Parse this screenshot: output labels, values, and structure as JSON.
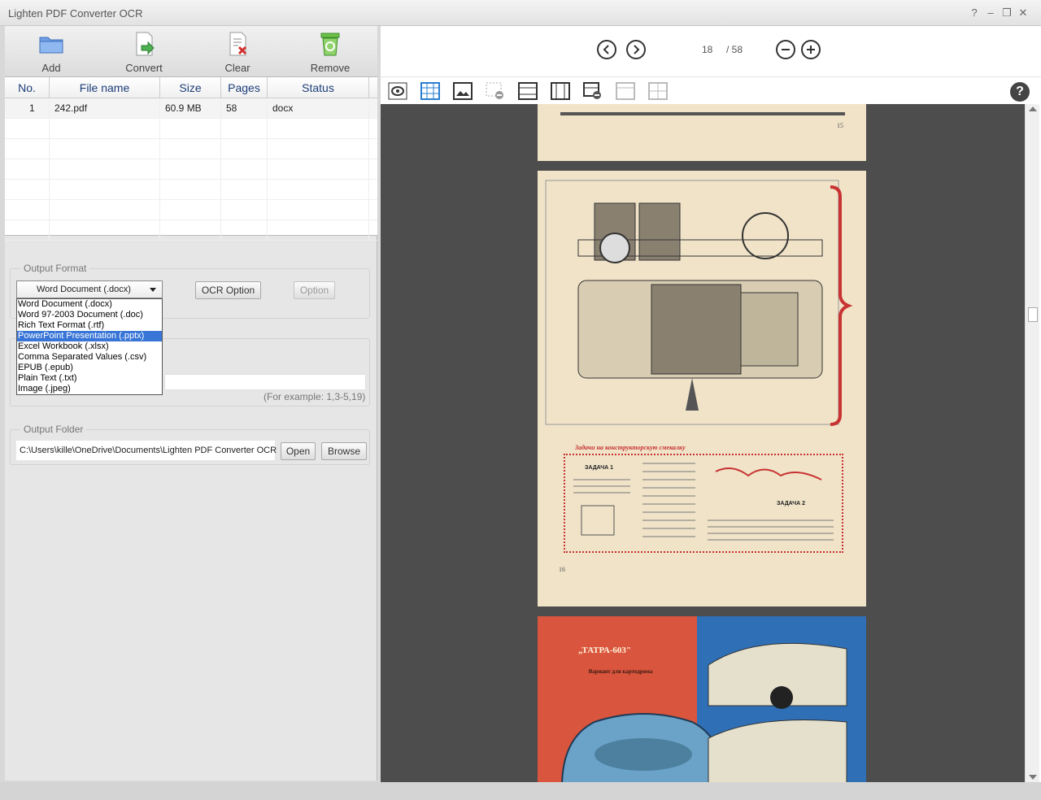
{
  "app": {
    "title": "Lighten PDF Converter OCR"
  },
  "window_controls": {
    "help": "?",
    "minimize": "–",
    "restore": "❐",
    "close": "✕"
  },
  "toolbar": {
    "add_label": "Add",
    "convert_label": "Convert",
    "clear_label": "Clear",
    "remove_label": "Remove"
  },
  "file_table": {
    "headers": {
      "no": "No.",
      "name": "File name",
      "size": "Size",
      "pages": "Pages",
      "status": "Status"
    },
    "rows": [
      {
        "no": "1",
        "name": "242.pdf",
        "size": "60.9 MB",
        "pages": "58",
        "status": "docx"
      }
    ]
  },
  "output_format": {
    "group_label": "Output Format",
    "selected": "Word Document (.docx)",
    "ocr_button": "OCR Option",
    "option_button": "Option",
    "options": [
      "Word Document (.docx)",
      "Word 97-2003 Document (.doc)",
      "Rich Text Format (.rtf)",
      "PowerPoint Presentation (.pptx)",
      "Excel Workbook (.xlsx)",
      "Comma Separated Values (.csv)",
      "EPUB (.epub)",
      "Plain Text (.txt)",
      "Image (.jpeg)"
    ],
    "highlighted_index": 3
  },
  "page_range": {
    "hint": "(For example: 1,3-5,19)"
  },
  "output_folder": {
    "group_label": "Output Folder",
    "path": "C:\\Users\\kille\\OneDrive\\Documents\\Lighten PDF Converter OCR",
    "open_button": "Open",
    "browse_button": "Browse"
  },
  "viewer": {
    "current_page": "18",
    "total_pages": "/ 58",
    "help": "?",
    "page_number_top": "15",
    "page_number_mid": "16",
    "poster_title": "„ТАТРА-603\"",
    "poster_subtitle": "Вариант для картодрома",
    "heading_ru": "Задачи на конструкторскую смекалку",
    "task1_label": "ЗАДАЧА 1",
    "task2_label": "ЗАДАЧА 2"
  },
  "colors": {
    "selection": "#3875d7",
    "header_text": "#1c3d78",
    "viewer_bg": "#4d4d4d",
    "page_paper": "#f0e3c8",
    "poster_red": "#d9553d",
    "poster_blue": "#2f6fb6"
  }
}
